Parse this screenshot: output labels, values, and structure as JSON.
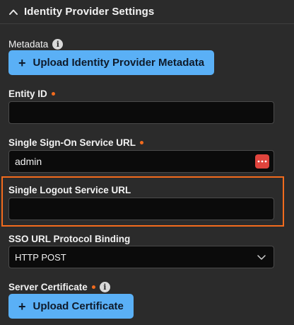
{
  "section": {
    "title": "Identity Provider Settings"
  },
  "metadata": {
    "label": "Metadata",
    "button_label": "Upload Identity Provider Metadata"
  },
  "entity_id": {
    "label": "Entity ID",
    "value": ""
  },
  "sso_url": {
    "label": "Single Sign-On Service URL",
    "value": "admin"
  },
  "slo_url": {
    "label": "Single Logout Service URL",
    "value": ""
  },
  "protocol_binding": {
    "label": "SSO URL Protocol Binding",
    "selected": "HTTP POST"
  },
  "server_certificate": {
    "label": "Server Certificate",
    "button_label": "Upload Certificate"
  },
  "colors": {
    "accent": "#5ab0f6",
    "required": "#f26b1d",
    "highlight": "#f26b1d",
    "background": "#2b2b2b"
  },
  "icons": {
    "collapse": "chevron-up-icon",
    "info": "info-icon",
    "add": "plus-icon",
    "password_manager": "password-manager-icon",
    "dropdown": "chevron-down-icon"
  }
}
